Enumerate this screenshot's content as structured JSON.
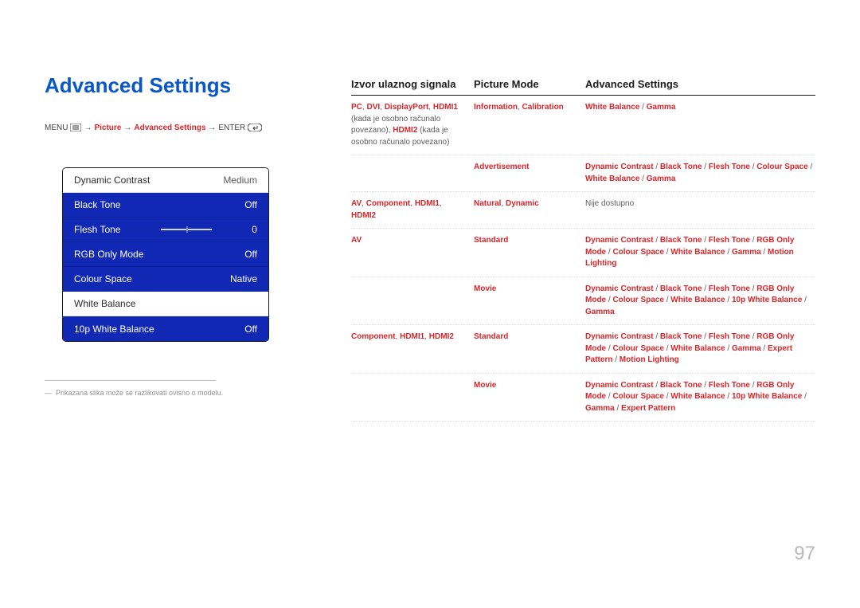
{
  "title": "Advanced Settings",
  "breadcrumb": {
    "menu": "MENU",
    "picture": "Picture",
    "advanced": "Advanced Settings",
    "enter": "ENTER"
  },
  "menu": [
    {
      "label": "Dynamic Contrast",
      "value": "Medium",
      "style": "white"
    },
    {
      "label": "Black Tone",
      "value": "Off",
      "style": "blue"
    },
    {
      "label": "Flesh Tone",
      "value": "0",
      "style": "blue",
      "slider": true
    },
    {
      "label": "RGB Only Mode",
      "value": "Off",
      "style": "blue"
    },
    {
      "label": "Colour Space",
      "value": "Native",
      "style": "blue"
    },
    {
      "label": "White Balance",
      "value": "",
      "style": "white"
    },
    {
      "label": "10p White Balance",
      "value": "Off",
      "style": "blue"
    }
  ],
  "footnote": "Prikazana slika može se razlikovati ovisno o modelu.",
  "table": {
    "headers": {
      "c1": "Izvor ulaznog signala",
      "c2": "Picture Mode",
      "c3": "Advanced Settings"
    },
    "rows": [
      {
        "c1": "<span class='red'>PC</span><span class='gray'>, </span><span class='red'>DVI</span><span class='gray'>, </span><span class='red'>DisplayPort</span><span class='gray'>, </span><span class='red'>HDMI1</span><span class='gray'> (kada je osobno računalo povezano), </span><span class='red'>HDMI2</span><span class='gray'> (kada je osobno računalo povezano)</span>",
        "sub": [
          {
            "c2": "<span class='red'>Information</span><span class='gray'>, </span><span class='red'>Calibration</span>",
            "c3": "<span class='red'>White Balance</span><span class='gray'> / </span><span class='red'>Gamma</span>"
          },
          {
            "c2": "<span class='red'>Advertisement</span>",
            "c3": "<span class='red'>Dynamic Contrast</span><span class='gray'> / </span><span class='red'>Black Tone</span><span class='gray'> / </span><span class='red'>Flesh Tone</span><span class='gray'> / </span><span class='red'>Colour Space</span><span class='gray'> / </span><span class='red'>White Balance</span><span class='gray'> / </span><span class='red'>Gamma</span>"
          }
        ]
      },
      {
        "c1": "<span class='red'>AV</span><span class='gray'>, </span><span class='red'>Component</span><span class='gray'>, </span><span class='red'>HDMI1</span><span class='gray'>, </span><span class='red'>HDMI2</span>",
        "sub": [
          {
            "c2": "<span class='red'>Natural</span><span class='gray'>, </span><span class='red'>Dynamic</span>",
            "c3": "<span class='gray'>Nije dostupno</span>"
          }
        ]
      },
      {
        "c1": "<span class='red'>AV</span>",
        "sub": [
          {
            "c2": "<span class='red'>Standard</span>",
            "c3": "<span class='red'>Dynamic Contrast</span><span class='gray'> / </span><span class='red'>Black Tone</span><span class='gray'> / </span><span class='red'>Flesh Tone</span><span class='gray'> / </span><span class='red'>RGB Only Mode</span><span class='gray'> / </span><span class='red'>Colour Space</span><span class='gray'> / </span><span class='red'>White Balance</span><span class='gray'> / </span><span class='red'>Gamma</span><span class='gray'> / </span><span class='red'>Motion Lighting</span>"
          },
          {
            "c2": "<span class='red'>Movie</span>",
            "c3": "<span class='red'>Dynamic Contrast</span><span class='gray'> / </span><span class='red'>Black Tone</span><span class='gray'> / </span><span class='red'>Flesh Tone</span><span class='gray'> / </span><span class='red'>RGB Only Mode</span><span class='gray'> / </span><span class='red'>Colour Space</span><span class='gray'> / </span><span class='red'>White Balance</span><span class='gray'> / </span><span class='red'>10p White Balance</span><span class='gray'> / </span><span class='red'>Gamma</span>"
          }
        ]
      },
      {
        "c1": "<span class='red'>Component</span><span class='gray'>, </span><span class='red'>HDMI1</span><span class='gray'>, </span><span class='red'>HDMI2</span>",
        "sub": [
          {
            "c2": "<span class='red'>Standard</span>",
            "c3": "<span class='red'>Dynamic Contrast</span><span class='gray'> / </span><span class='red'>Black Tone</span><span class='gray'> / </span><span class='red'>Flesh Tone</span><span class='gray'> / </span><span class='red'>RGB Only Mode</span><span class='gray'> / </span><span class='red'>Colour Space</span><span class='gray'> / </span><span class='red'>White Balance</span><span class='gray'> / </span><span class='red'>Gamma</span><span class='gray'> / </span><span class='red'>Expert Pattern</span><span class='gray'> / </span><span class='red'>Motion Lighting</span>"
          },
          {
            "c2": "<span class='red'>Movie</span>",
            "c3": "<span class='red'>Dynamic Contrast</span><span class='gray'> / </span><span class='red'>Black Tone</span><span class='gray'> / </span><span class='red'>Flesh Tone</span><span class='gray'> / </span><span class='red'>RGB Only Mode</span><span class='gray'> / </span><span class='red'>Colour Space</span><span class='gray'> / </span><span class='red'>White Balance</span><span class='gray'> / </span><span class='red'>10p White Balance</span><span class='gray'> / </span><span class='red'>Gamma</span><span class='gray'> / </span><span class='red'>Expert Pattern</span>"
          }
        ]
      }
    ]
  },
  "pageNumber": "97"
}
